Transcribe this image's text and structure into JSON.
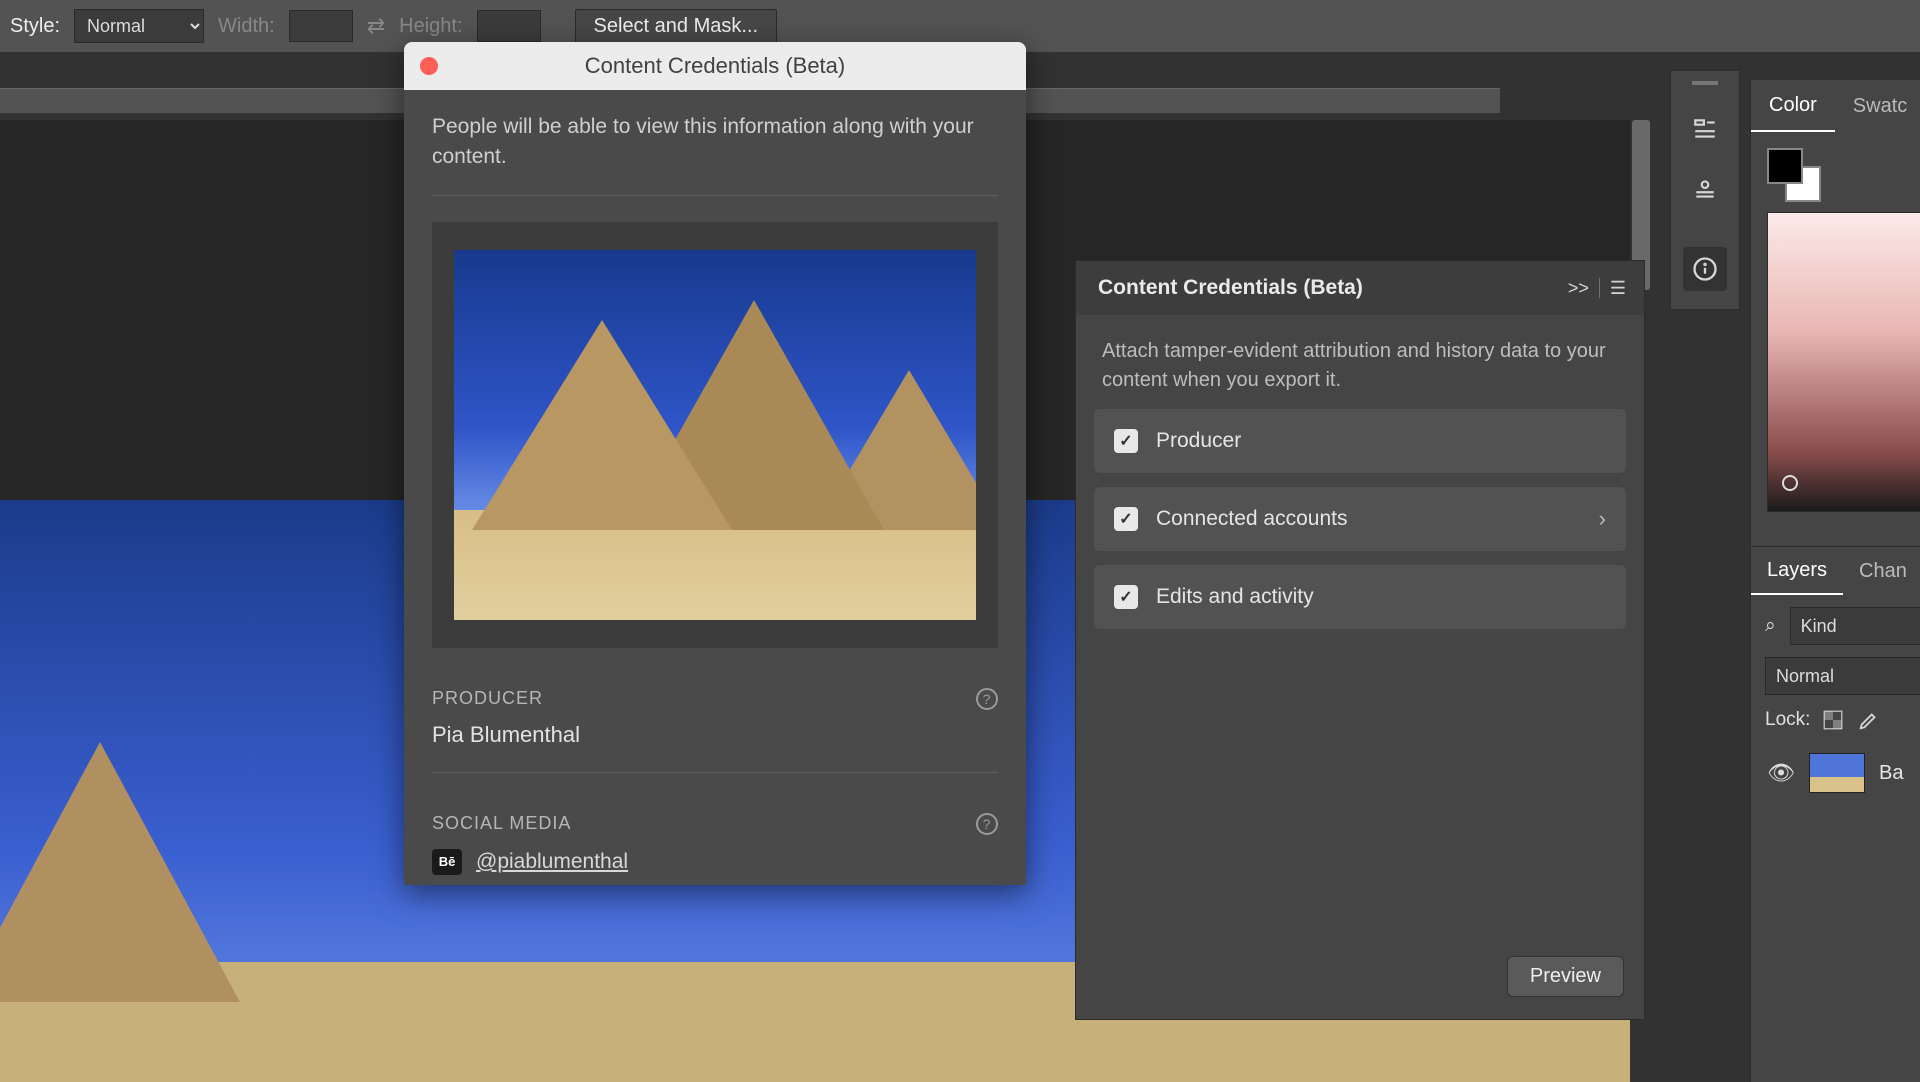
{
  "options": {
    "style_label": "Style:",
    "style_value": "Normal",
    "width_label": "Width:",
    "height_label": "Height:",
    "select_mask": "Select and Mask..."
  },
  "dialog": {
    "title": "Content Credentials (Beta)",
    "description": "People will be able to view this information along with your content.",
    "producer_heading": "PRODUCER",
    "producer_name": "Pia Blumenthal",
    "social_heading": "SOCIAL MEDIA",
    "behance_badge": "Bē",
    "social_handle": "@piablumenthal"
  },
  "cc_panel": {
    "title": "Content Credentials (Beta)",
    "expand": ">>",
    "description": "Attach tamper-evident attribution and history data to your content when you export it.",
    "rows": {
      "producer": "Producer",
      "connected": "Connected accounts",
      "edits": "Edits and activity"
    },
    "preview_btn": "Preview"
  },
  "right": {
    "tab_color": "Color",
    "tab_swatches": "Swatc",
    "tab_layers": "Layers",
    "tab_channels": "Chan",
    "kind_label": "Kind",
    "blend_mode": "Normal",
    "lock_label": "Lock:",
    "layer_name": "Ba"
  },
  "icons": {
    "search": "⌕"
  }
}
